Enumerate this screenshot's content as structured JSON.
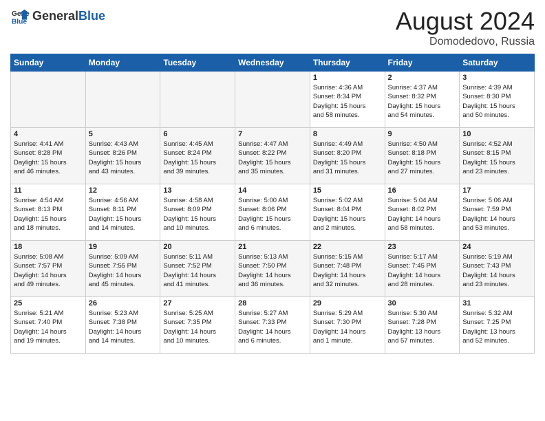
{
  "header": {
    "logo_general": "General",
    "logo_blue": "Blue",
    "month_year": "August 2024",
    "location": "Domodedovo, Russia"
  },
  "weekdays": [
    "Sunday",
    "Monday",
    "Tuesday",
    "Wednesday",
    "Thursday",
    "Friday",
    "Saturday"
  ],
  "weeks": [
    [
      {
        "day": "",
        "info": ""
      },
      {
        "day": "",
        "info": ""
      },
      {
        "day": "",
        "info": ""
      },
      {
        "day": "",
        "info": ""
      },
      {
        "day": "1",
        "info": "Sunrise: 4:36 AM\nSunset: 8:34 PM\nDaylight: 15 hours\nand 58 minutes."
      },
      {
        "day": "2",
        "info": "Sunrise: 4:37 AM\nSunset: 8:32 PM\nDaylight: 15 hours\nand 54 minutes."
      },
      {
        "day": "3",
        "info": "Sunrise: 4:39 AM\nSunset: 8:30 PM\nDaylight: 15 hours\nand 50 minutes."
      }
    ],
    [
      {
        "day": "4",
        "info": "Sunrise: 4:41 AM\nSunset: 8:28 PM\nDaylight: 15 hours\nand 46 minutes."
      },
      {
        "day": "5",
        "info": "Sunrise: 4:43 AM\nSunset: 8:26 PM\nDaylight: 15 hours\nand 43 minutes."
      },
      {
        "day": "6",
        "info": "Sunrise: 4:45 AM\nSunset: 8:24 PM\nDaylight: 15 hours\nand 39 minutes."
      },
      {
        "day": "7",
        "info": "Sunrise: 4:47 AM\nSunset: 8:22 PM\nDaylight: 15 hours\nand 35 minutes."
      },
      {
        "day": "8",
        "info": "Sunrise: 4:49 AM\nSunset: 8:20 PM\nDaylight: 15 hours\nand 31 minutes."
      },
      {
        "day": "9",
        "info": "Sunrise: 4:50 AM\nSunset: 8:18 PM\nDaylight: 15 hours\nand 27 minutes."
      },
      {
        "day": "10",
        "info": "Sunrise: 4:52 AM\nSunset: 8:15 PM\nDaylight: 15 hours\nand 23 minutes."
      }
    ],
    [
      {
        "day": "11",
        "info": "Sunrise: 4:54 AM\nSunset: 8:13 PM\nDaylight: 15 hours\nand 18 minutes."
      },
      {
        "day": "12",
        "info": "Sunrise: 4:56 AM\nSunset: 8:11 PM\nDaylight: 15 hours\nand 14 minutes."
      },
      {
        "day": "13",
        "info": "Sunrise: 4:58 AM\nSunset: 8:09 PM\nDaylight: 15 hours\nand 10 minutes."
      },
      {
        "day": "14",
        "info": "Sunrise: 5:00 AM\nSunset: 8:06 PM\nDaylight: 15 hours\nand 6 minutes."
      },
      {
        "day": "15",
        "info": "Sunrise: 5:02 AM\nSunset: 8:04 PM\nDaylight: 15 hours\nand 2 minutes."
      },
      {
        "day": "16",
        "info": "Sunrise: 5:04 AM\nSunset: 8:02 PM\nDaylight: 14 hours\nand 58 minutes."
      },
      {
        "day": "17",
        "info": "Sunrise: 5:06 AM\nSunset: 7:59 PM\nDaylight: 14 hours\nand 53 minutes."
      }
    ],
    [
      {
        "day": "18",
        "info": "Sunrise: 5:08 AM\nSunset: 7:57 PM\nDaylight: 14 hours\nand 49 minutes."
      },
      {
        "day": "19",
        "info": "Sunrise: 5:09 AM\nSunset: 7:55 PM\nDaylight: 14 hours\nand 45 minutes."
      },
      {
        "day": "20",
        "info": "Sunrise: 5:11 AM\nSunset: 7:52 PM\nDaylight: 14 hours\nand 41 minutes."
      },
      {
        "day": "21",
        "info": "Sunrise: 5:13 AM\nSunset: 7:50 PM\nDaylight: 14 hours\nand 36 minutes."
      },
      {
        "day": "22",
        "info": "Sunrise: 5:15 AM\nSunset: 7:48 PM\nDaylight: 14 hours\nand 32 minutes."
      },
      {
        "day": "23",
        "info": "Sunrise: 5:17 AM\nSunset: 7:45 PM\nDaylight: 14 hours\nand 28 minutes."
      },
      {
        "day": "24",
        "info": "Sunrise: 5:19 AM\nSunset: 7:43 PM\nDaylight: 14 hours\nand 23 minutes."
      }
    ],
    [
      {
        "day": "25",
        "info": "Sunrise: 5:21 AM\nSunset: 7:40 PM\nDaylight: 14 hours\nand 19 minutes."
      },
      {
        "day": "26",
        "info": "Sunrise: 5:23 AM\nSunset: 7:38 PM\nDaylight: 14 hours\nand 14 minutes."
      },
      {
        "day": "27",
        "info": "Sunrise: 5:25 AM\nSunset: 7:35 PM\nDaylight: 14 hours\nand 10 minutes."
      },
      {
        "day": "28",
        "info": "Sunrise: 5:27 AM\nSunset: 7:33 PM\nDaylight: 14 hours\nand 6 minutes."
      },
      {
        "day": "29",
        "info": "Sunrise: 5:29 AM\nSunset: 7:30 PM\nDaylight: 14 hours\nand 1 minute."
      },
      {
        "day": "30",
        "info": "Sunrise: 5:30 AM\nSunset: 7:28 PM\nDaylight: 13 hours\nand 57 minutes."
      },
      {
        "day": "31",
        "info": "Sunrise: 5:32 AM\nSunset: 7:25 PM\nDaylight: 13 hours\nand 52 minutes."
      }
    ]
  ]
}
